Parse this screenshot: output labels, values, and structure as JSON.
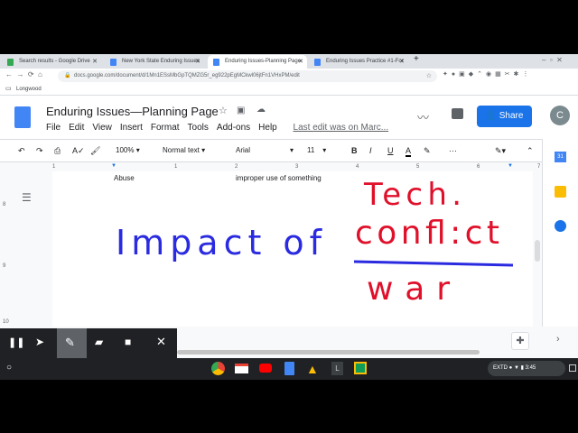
{
  "tabs": [
    {
      "label": "Search results - Google Drive"
    },
    {
      "label": "New York State Enduring Issues"
    },
    {
      "label": "Enduring Issues-Planning Page"
    },
    {
      "label": "Enduring Issues Practice #1-For"
    }
  ],
  "url": "docs.google.com/document/d/1Mn1ESsMbGpTQMZG5r_eg922pEgMCkwl06jtFn1VHxPM/edit",
  "bookmark": "Longwood",
  "doc": {
    "title": "Enduring Issues—Planning Page",
    "menus": [
      "File",
      "Edit",
      "View",
      "Insert",
      "Format",
      "Tools",
      "Add-ons",
      "Help"
    ],
    "last_edit": "Last edit was on Marc...",
    "share": "Share",
    "avatar": "C"
  },
  "toolbar": {
    "zoom": "100%",
    "style": "Normal text",
    "font": "Arial",
    "size": "11",
    "bold": "B",
    "italic": "I",
    "underline": "U",
    "color": "A",
    "more": "···"
  },
  "ruler": [
    "1",
    "1",
    "2",
    "3",
    "4",
    "5",
    "6",
    "7"
  ],
  "margin": [
    "8",
    "9",
    "10"
  ],
  "page": {
    "term": "Abuse",
    "definition": "improper use of something",
    "hand_blue": "Impact of",
    "hand_red": [
      "Tech.",
      "confl:ct",
      "war"
    ]
  },
  "side": {
    "calendar": "31"
  },
  "shelf": {
    "launcher_l": "L",
    "status": "EXTD",
    "time": "3:45"
  },
  "colors": {
    "blue_ink": "#2a2ae0",
    "red_ink": "#e0102a",
    "share": "#1a73e8"
  }
}
